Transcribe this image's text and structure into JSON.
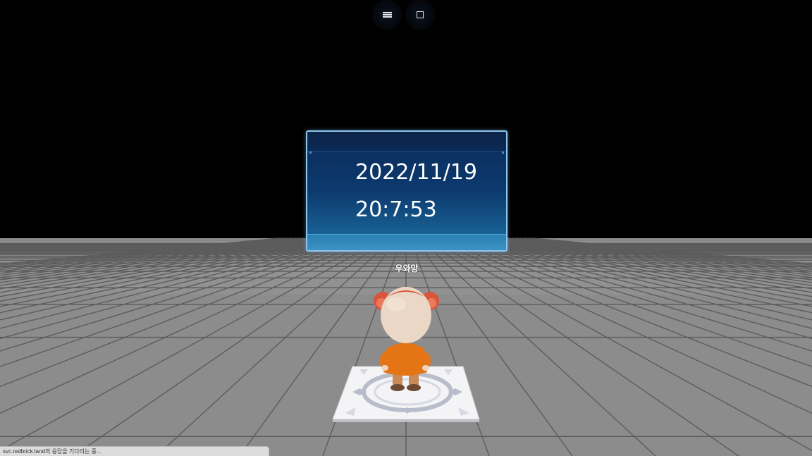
{
  "toolbar": {
    "menu_icon": "hamburger-menu-icon",
    "window_icon": "square-window-icon"
  },
  "board": {
    "date": "2022/11/19",
    "time": "20:7:53"
  },
  "player": {
    "name": "우와앙"
  },
  "status": {
    "text": "svc.redbrick.land의 응답을 기다리는 중..."
  },
  "colors": {
    "board_top": "#0a2a5a",
    "board_bottom": "#2a7fb0",
    "board_border": "#8fc6ee",
    "floor": "#8c8c8c"
  }
}
